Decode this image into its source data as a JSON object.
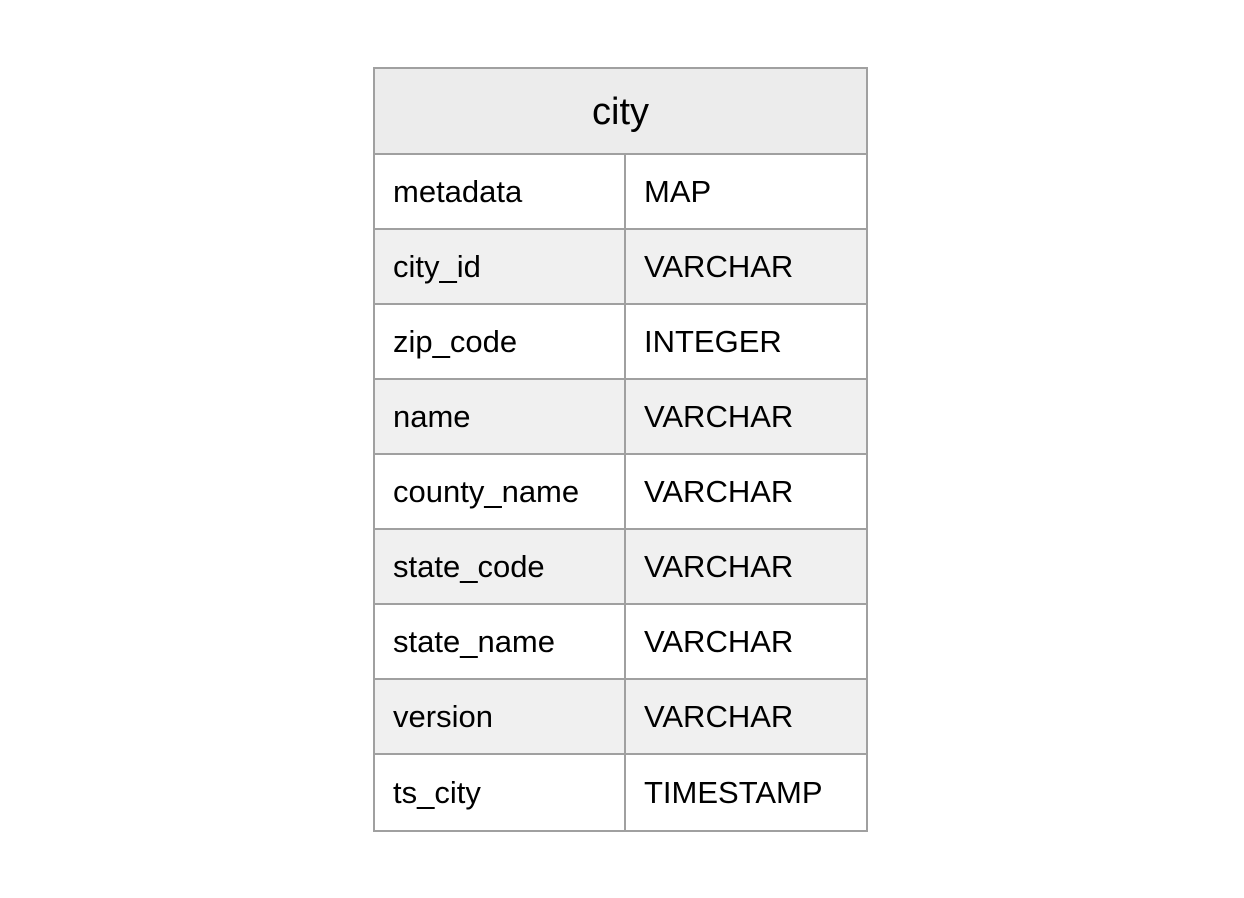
{
  "diagram": {
    "type": "entity-relationship-table",
    "colors": {
      "background": "#ffffff",
      "border": "#a0a0a0",
      "header_fill": "#ececec",
      "row_fill_alt": "#f0f0f0",
      "row_fill_plain": "#ffffff",
      "text": "#000000"
    },
    "entity": {
      "title": "city",
      "fields": [
        {
          "name": "metadata",
          "type": "MAP"
        },
        {
          "name": "city_id",
          "type": "VARCHAR"
        },
        {
          "name": "zip_code",
          "type": "INTEGER"
        },
        {
          "name": "name",
          "type": "VARCHAR"
        },
        {
          "name": "county_name",
          "type": "VARCHAR"
        },
        {
          "name": "state_code",
          "type": "VARCHAR"
        },
        {
          "name": "state_name",
          "type": "VARCHAR"
        },
        {
          "name": "version",
          "type": "VARCHAR"
        },
        {
          "name": "ts_city",
          "type": "TIMESTAMP"
        }
      ]
    }
  }
}
